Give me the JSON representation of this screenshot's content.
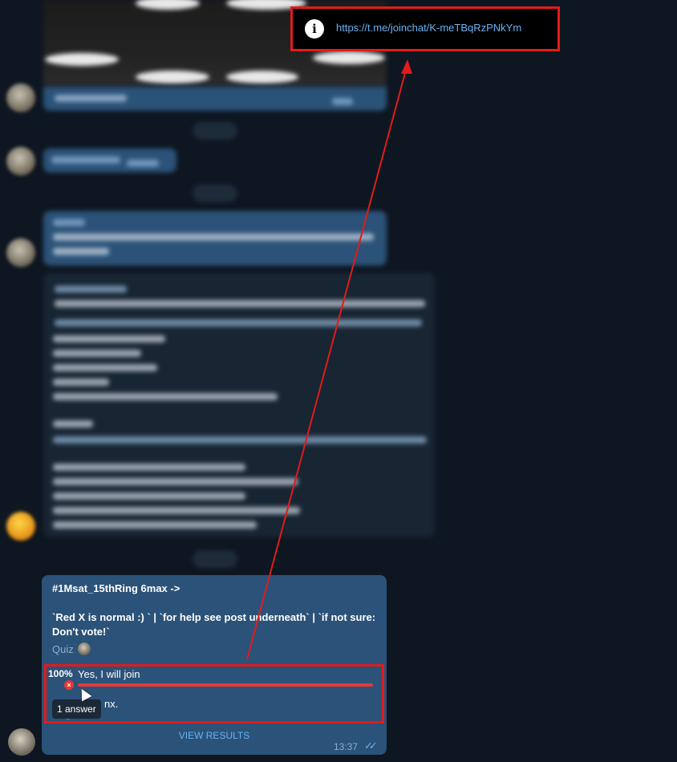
{
  "link_tooltip": {
    "icon": "info-icon",
    "url": "https://t.me/joinchat/K-meTBqRzPNkYm"
  },
  "poll": {
    "title": "#1Msat_15thRing  6max ->",
    "description": "`Red X is normal :) ` | `for help see post underneath` | `if not sure: Don't vote!`",
    "type_label": "Quiz",
    "options": [
      {
        "percent": "100%",
        "label": "Yes, I will join",
        "result": 1.0,
        "wrong_mark": "×"
      },
      {
        "label": "nx."
      }
    ],
    "answers_tooltip": "1 answer",
    "view_results_label": "VIEW RESULTS",
    "time": "13:37",
    "read_status": "✓✓"
  },
  "colors": {
    "background": "#0e1621",
    "bubble": "#2b5278",
    "accent": "#6ab2f2",
    "annotation_red": "#e21b1b"
  }
}
